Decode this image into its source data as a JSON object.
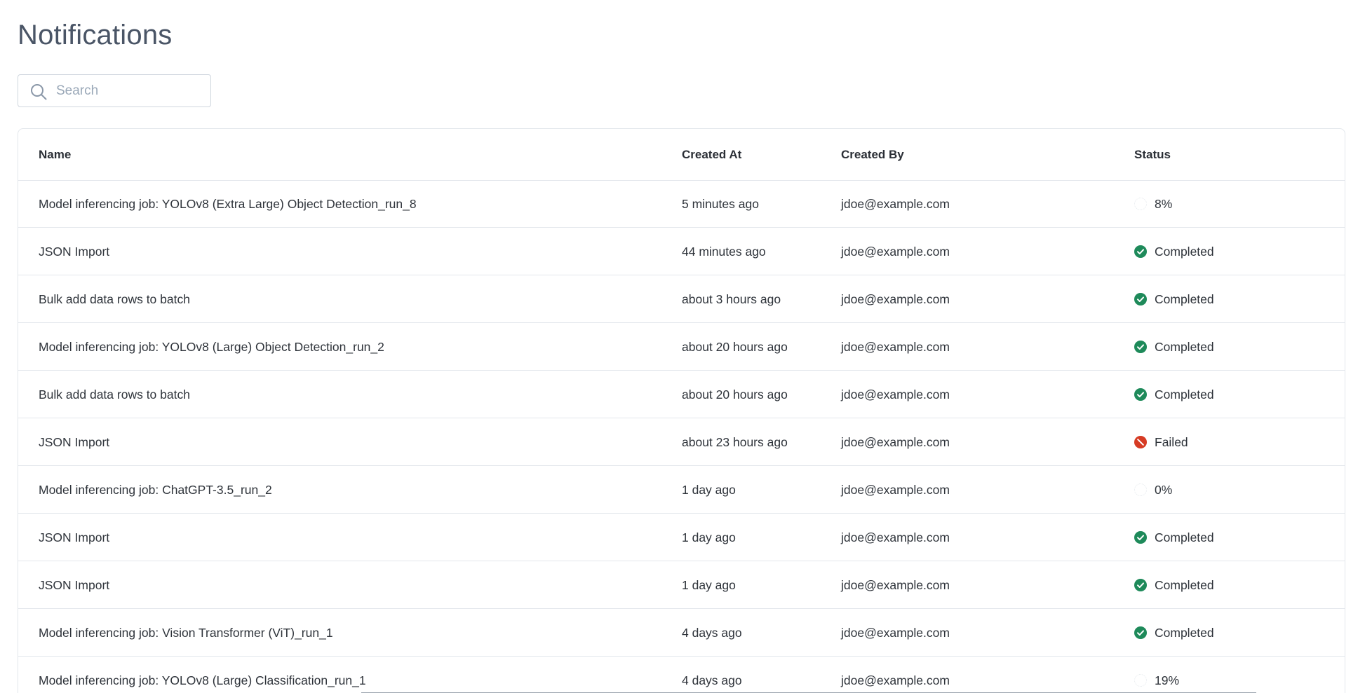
{
  "page": {
    "title": "Notifications"
  },
  "search": {
    "placeholder": "Search",
    "value": ""
  },
  "table": {
    "columns": {
      "name": "Name",
      "created_at": "Created At",
      "created_by": "Created By",
      "status": "Status"
    },
    "rows": [
      {
        "name": "Model inferencing job: YOLOv8 (Extra Large) Object Detection_run_8",
        "created_at": "5 minutes ago",
        "created_by": "jdoe@example.com",
        "status": "8%",
        "status_type": "progress"
      },
      {
        "name": "JSON Import",
        "created_at": "44 minutes ago",
        "created_by": "jdoe@example.com",
        "status": "Completed",
        "status_type": "completed"
      },
      {
        "name": "Bulk add data rows to batch",
        "created_at": "about 3 hours ago",
        "created_by": "jdoe@example.com",
        "status": "Completed",
        "status_type": "completed"
      },
      {
        "name": "Model inferencing job: YOLOv8 (Large) Object Detection_run_2",
        "created_at": "about 20 hours ago",
        "created_by": "jdoe@example.com",
        "status": "Completed",
        "status_type": "completed"
      },
      {
        "name": "Bulk add data rows to batch",
        "created_at": "about 20 hours ago",
        "created_by": "jdoe@example.com",
        "status": "Completed",
        "status_type": "completed"
      },
      {
        "name": "JSON Import",
        "created_at": "about 23 hours ago",
        "created_by": "jdoe@example.com",
        "status": "Failed",
        "status_type": "failed"
      },
      {
        "name": "Model inferencing job: ChatGPT-3.5_run_2",
        "created_at": "1 day ago",
        "created_by": "jdoe@example.com",
        "status": "0%",
        "status_type": "progress"
      },
      {
        "name": "JSON Import",
        "created_at": "1 day ago",
        "created_by": "jdoe@example.com",
        "status": "Completed",
        "status_type": "completed"
      },
      {
        "name": "JSON Import",
        "created_at": "1 day ago",
        "created_by": "jdoe@example.com",
        "status": "Completed",
        "status_type": "completed"
      },
      {
        "name": "Model inferencing job: Vision Transformer (ViT)_run_1",
        "created_at": "4 days ago",
        "created_by": "jdoe@example.com",
        "status": "Completed",
        "status_type": "completed"
      },
      {
        "name": "Model inferencing job: YOLOv8 (Large) Classification_run_1",
        "created_at": "4 days ago",
        "created_by": "jdoe@example.com",
        "status": "19%",
        "status_type": "progress"
      }
    ]
  },
  "colors": {
    "completed": "#1e8a5a",
    "failed": "#d63b24",
    "title": "#4a5566",
    "border": "#e3e7ec"
  },
  "icons": {
    "search": "search-icon",
    "completed": "check-circle-icon",
    "failed": "no-entry-icon",
    "progress": "progress-ring-icon"
  }
}
